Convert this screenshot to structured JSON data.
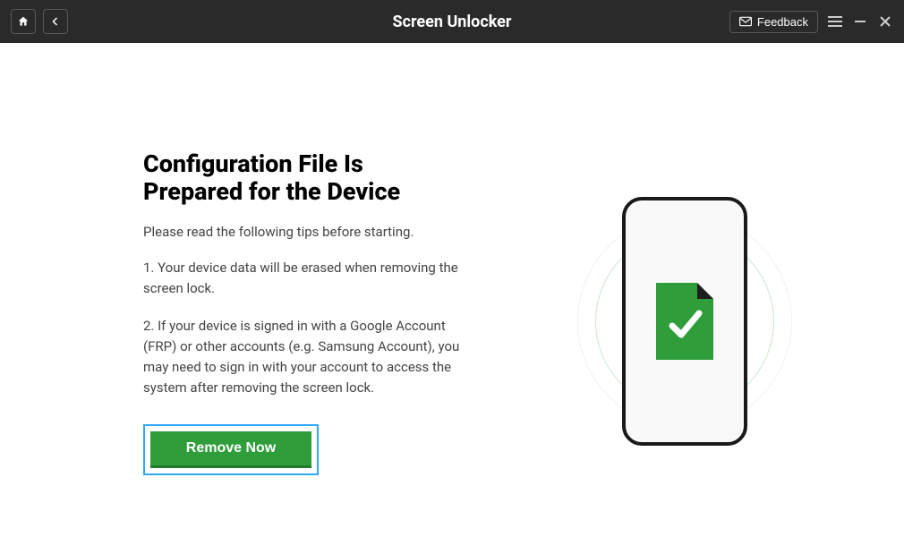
{
  "header": {
    "title": "Screen Unlocker",
    "feedback_label": "Feedback"
  },
  "main": {
    "heading": "Configuration File Is Prepared for the Device",
    "subtitle": "Please read the following tips before starting.",
    "tips": [
      "1. Your device data will be erased when removing the screen lock.",
      "2. If your device is signed in with a Google Account (FRP) or other accounts (e.g. Samsung Account), you may need to sign in with your account to access the system after removing the screen lock."
    ],
    "cta_label": "Remove Now"
  },
  "colors": {
    "accent_green": "#2e9d3a",
    "highlight_blue": "#2fa8ff",
    "header_bg": "#2a2a2a"
  }
}
